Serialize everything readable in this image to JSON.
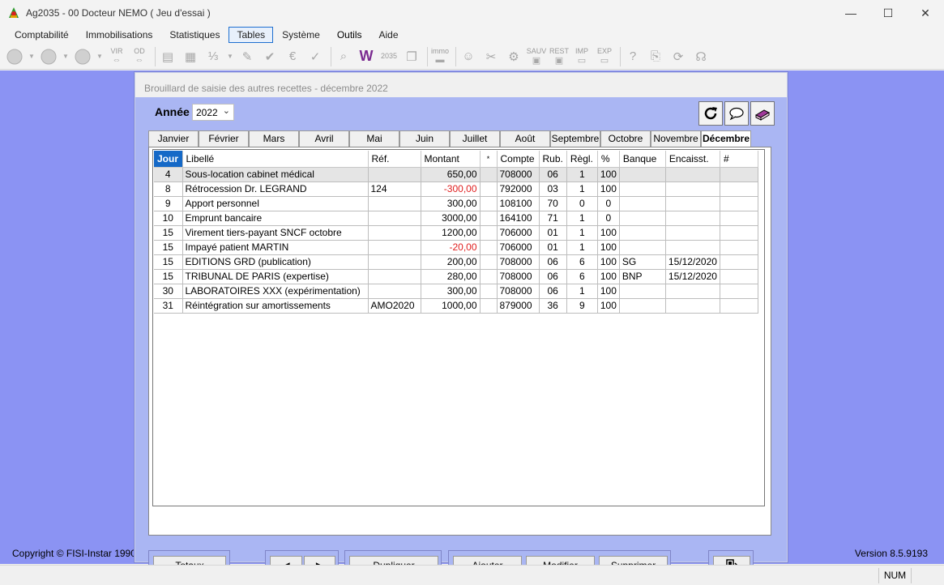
{
  "window": {
    "title": "Ag2035 - 00 Docteur NEMO  ( Jeu d'essai )",
    "minimize": "—",
    "maximize": "☐",
    "close": "✕"
  },
  "menu": [
    "Comptabilité",
    "Immobilisations",
    "Statistiques",
    "Tables",
    "Système",
    "Outils",
    "Aide"
  ],
  "toolbar": {
    "vir": "VIR",
    "od": "OD",
    "year": "2035",
    "immo": "immo",
    "sauv": "SAUV",
    "rest": "REST",
    "imp": "IMP",
    "exp": "EXP"
  },
  "footer": {
    "copyright": "Copyright © FISI-Instar 1990",
    "version": "Version 8.5.9193",
    "num": "NUM"
  },
  "dialog": {
    "title": "Brouillard de saisie des autres recettes - décembre 2022",
    "year_label": "Année",
    "year_value": "2022",
    "tabs": [
      "Janvier",
      "Février",
      "Mars",
      "Avril",
      "Mai",
      "Juin",
      "Juillet",
      "Août",
      "Septembre",
      "Octobre",
      "Novembre",
      "Décembre"
    ],
    "columns": [
      "Jour",
      "Libellé",
      "Réf.",
      "Montant",
      "*",
      "Compte",
      "Rub.",
      "Règl.",
      "%",
      "Banque",
      "Encaisst.",
      "#"
    ],
    "rows": [
      {
        "jour": "4",
        "libelle": "Sous-location cabinet médical",
        "ref": "",
        "montant": "650,00",
        "star": "",
        "compte": "708000",
        "rub": "06",
        "regl": "1",
        "pct": "100",
        "banque": "",
        "encaisst": "",
        "hash": ""
      },
      {
        "jour": "8",
        "libelle": "Rétrocession Dr. LEGRAND",
        "ref": "124",
        "montant": "-300,00",
        "star": "",
        "compte": "792000",
        "rub": "03",
        "regl": "1",
        "pct": "100",
        "banque": "",
        "encaisst": "",
        "hash": ""
      },
      {
        "jour": "9",
        "libelle": "Apport personnel",
        "ref": "",
        "montant": "300,00",
        "star": "",
        "compte": "108100",
        "rub": "70",
        "regl": "0",
        "pct": "0",
        "banque": "",
        "encaisst": "",
        "hash": ""
      },
      {
        "jour": "10",
        "libelle": "Emprunt bancaire",
        "ref": "",
        "montant": "3000,00",
        "star": "",
        "compte": "164100",
        "rub": "71",
        "regl": "1",
        "pct": "0",
        "banque": "",
        "encaisst": "",
        "hash": ""
      },
      {
        "jour": "15",
        "libelle": "Virement tiers-payant SNCF octobre",
        "ref": "",
        "montant": "1200,00",
        "star": "",
        "compte": "706000",
        "rub": "01",
        "regl": "1",
        "pct": "100",
        "banque": "",
        "encaisst": "",
        "hash": ""
      },
      {
        "jour": "15",
        "libelle": "Impayé patient MARTIN",
        "ref": "",
        "montant": "-20,00",
        "star": "",
        "compte": "706000",
        "rub": "01",
        "regl": "1",
        "pct": "100",
        "banque": "",
        "encaisst": "",
        "hash": ""
      },
      {
        "jour": "15",
        "libelle": "EDITIONS GRD (publication)",
        "ref": "",
        "montant": "200,00",
        "star": "",
        "compte": "708000",
        "rub": "06",
        "regl": "6",
        "pct": "100",
        "banque": "SG",
        "encaisst": "15/12/2020",
        "hash": ""
      },
      {
        "jour": "15",
        "libelle": "TRIBUNAL DE PARIS (expertise)",
        "ref": "",
        "montant": "280,00",
        "star": "",
        "compte": "708000",
        "rub": "06",
        "regl": "6",
        "pct": "100",
        "banque": "BNP",
        "encaisst": "15/12/2020",
        "hash": ""
      },
      {
        "jour": "30",
        "libelle": "LABORATOIRES XXX (expérimentation)",
        "ref": "",
        "montant": "300,00",
        "star": "",
        "compte": "708000",
        "rub": "06",
        "regl": "1",
        "pct": "100",
        "banque": "",
        "encaisst": "",
        "hash": ""
      },
      {
        "jour": "31",
        "libelle": "Réintégration sur amortissements",
        "ref": "AMO2020",
        "montant": "1000,00",
        "star": "",
        "compte": "879000",
        "rub": "36",
        "regl": "9",
        "pct": "100",
        "banque": "",
        "encaisst": "",
        "hash": ""
      }
    ],
    "buttons": {
      "totaux": "Totaux",
      "prev": "◀",
      "next": "▶",
      "dupliquer": "Dupliquer",
      "ajouter": "Ajouter",
      "modifier": "Modifier",
      "supprimer": "Supprimer"
    }
  },
  "colors": {
    "workspace": "#8b93f3",
    "dialog": "#aab6f3",
    "selected_header": "#1569c7",
    "negative": "#e02020"
  }
}
